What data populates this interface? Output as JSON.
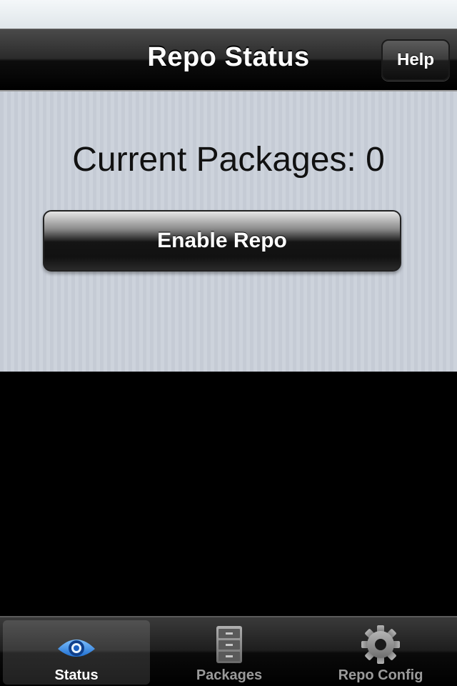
{
  "nav_bar": {
    "title": "Repo Status",
    "help_label": "Help"
  },
  "content": {
    "packages_label": "Current Packages: 0",
    "enable_button_label": "Enable Repo"
  },
  "tab_bar": {
    "tabs": [
      {
        "label": "Status",
        "icon": "eye-icon",
        "selected": true
      },
      {
        "label": "Packages",
        "icon": "filing-cabinet-icon",
        "selected": false
      },
      {
        "label": "Repo Config",
        "icon": "gear-icon",
        "selected": false
      }
    ]
  },
  "colors": {
    "content_background": "#c6ccd6",
    "selected_tab_icon": "#3d8ee6",
    "unselected_tab_icon": "#8a8a8a"
  }
}
